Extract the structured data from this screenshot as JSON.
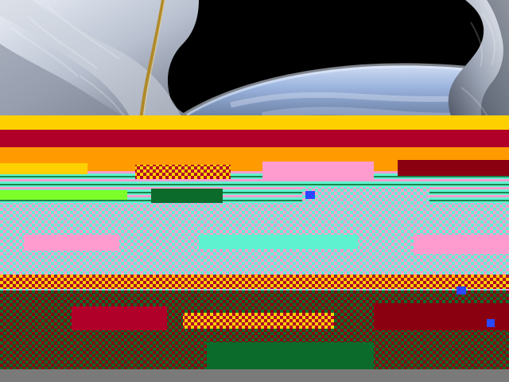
{
  "image": {
    "kind": "photo",
    "visible_subject": "space-horizon-with-spacecraft-foil",
    "artifact": "glitch-corruption"
  },
  "palette": {
    "space": "#000000",
    "earth_blue": "#6a86b8",
    "earth_haze": "#c9d6e8",
    "foil_light": "#d7dbe4",
    "foil_mid": "#a7aebc",
    "foil_dark": "#5f6675",
    "tether_gold": "#b08a2a",
    "glitch_yellow": "#ffd000",
    "glitch_red": "#b0002a",
    "glitch_pink": "#ff9ccf",
    "glitch_cyan": "#5ff2d0",
    "glitch_green": "#0b6b2a",
    "glitch_bright_green": "#7dff2a",
    "glitch_darkred": "#8a0010",
    "footer_gray": "#7a7a7a"
  }
}
